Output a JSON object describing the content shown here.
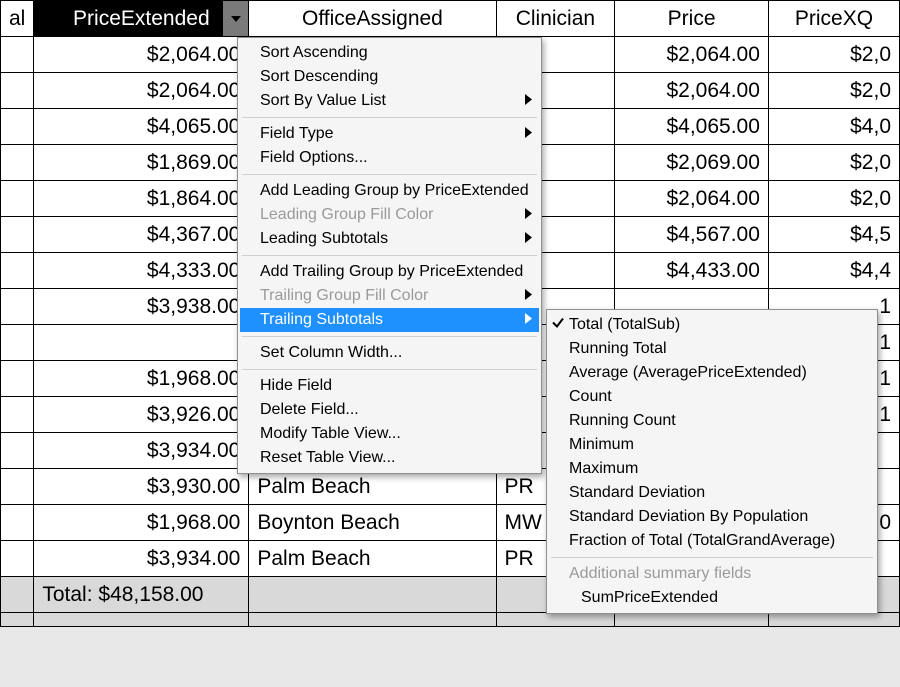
{
  "columns": {
    "stub": "al",
    "price_extended": "PriceExtended",
    "office_assigned": "OfficeAssigned",
    "clinician": "Clinician",
    "price": "Price",
    "price_xq": "PriceXQ"
  },
  "rows": [
    {
      "pe": "$2,064.00",
      "office": "",
      "clin": "",
      "price": "$2,064.00",
      "xq": "$2,0"
    },
    {
      "pe": "$2,064.00",
      "office": "",
      "clin": "",
      "price": "$2,064.00",
      "xq": "$2,0"
    },
    {
      "pe": "$4,065.00",
      "office": "",
      "clin": "",
      "price": "$4,065.00",
      "xq": "$4,0"
    },
    {
      "pe": "$1,869.00",
      "office": "",
      "clin": "",
      "price": "$2,069.00",
      "xq": "$2,0"
    },
    {
      "pe": "$1,864.00",
      "office": "",
      "clin": "",
      "price": "$2,064.00",
      "xq": "$2,0"
    },
    {
      "pe": "$4,367.00",
      "office": "",
      "clin": "",
      "price": "$4,567.00",
      "xq": "$4,5"
    },
    {
      "pe": "$4,333.00",
      "office": "",
      "clin": "",
      "price": "$4,433.00",
      "xq": "$4,4"
    },
    {
      "pe": "$3,938.00",
      "office": "",
      "clin": "",
      "price": "",
      "xq": "1"
    },
    {
      "pe": "",
      "office": "",
      "clin": "",
      "price": "",
      "xq": "1"
    },
    {
      "pe": "$1,968.00",
      "office": "",
      "clin": "",
      "price": "",
      "xq": "1"
    },
    {
      "pe": "$3,926.00",
      "office": "",
      "clin": "",
      "price": "",
      "xq": "1"
    },
    {
      "pe": "$3,934.00",
      "office": "",
      "clin": "",
      "price": "",
      "xq": ""
    },
    {
      "pe": "$3,930.00",
      "office": "Palm Beach",
      "clin": "PR",
      "price": "",
      "xq": ""
    },
    {
      "pe": "$1,968.00",
      "office": "Boynton Beach",
      "clin": "MW",
      "price": "",
      "xq": "0"
    },
    {
      "pe": "$3,934.00",
      "office": "Palm Beach",
      "clin": "PR",
      "price": "",
      "xq": ""
    }
  ],
  "total_label": "Total: $48,158.00",
  "menu_main": [
    {
      "label": "Sort Ascending",
      "disabled": false,
      "submenu": false
    },
    {
      "label": "Sort Descending",
      "disabled": false,
      "submenu": false
    },
    {
      "label": "Sort By Value List",
      "disabled": false,
      "submenu": true
    },
    {
      "sep": true
    },
    {
      "label": "Field Type",
      "disabled": false,
      "submenu": true
    },
    {
      "label": "Field Options...",
      "disabled": false,
      "submenu": false
    },
    {
      "sep": true
    },
    {
      "label": "Add Leading Group by PriceExtended",
      "disabled": false,
      "submenu": false
    },
    {
      "label": "Leading Group Fill Color",
      "disabled": true,
      "submenu": true
    },
    {
      "label": "Leading Subtotals",
      "disabled": false,
      "submenu": true
    },
    {
      "sep": true
    },
    {
      "label": "Add Trailing Group by PriceExtended",
      "disabled": false,
      "submenu": false
    },
    {
      "label": "Trailing Group Fill Color",
      "disabled": true,
      "submenu": true
    },
    {
      "label": "Trailing Subtotals",
      "disabled": false,
      "submenu": true,
      "highlight": true
    },
    {
      "sep": true
    },
    {
      "label": "Set Column Width...",
      "disabled": false,
      "submenu": false
    },
    {
      "sep": true
    },
    {
      "label": "Hide Field",
      "disabled": false,
      "submenu": false
    },
    {
      "label": "Delete Field...",
      "disabled": false,
      "submenu": false
    },
    {
      "label": "Modify Table View...",
      "disabled": false,
      "submenu": false
    },
    {
      "label": "Reset Table View...",
      "disabled": false,
      "submenu": false
    }
  ],
  "menu_sub": [
    {
      "label": "Total  (TotalSub)",
      "checked": true
    },
    {
      "label": "Running Total",
      "checked": false
    },
    {
      "label": "Average  (AveragePriceExtended)",
      "checked": false
    },
    {
      "label": "Count",
      "checked": false
    },
    {
      "label": "Running Count",
      "checked": false
    },
    {
      "label": "Minimum",
      "checked": false
    },
    {
      "label": "Maximum",
      "checked": false
    },
    {
      "label": "Standard Deviation",
      "checked": false
    },
    {
      "label": "Standard Deviation By Population",
      "checked": false
    },
    {
      "label": "Fraction of Total  (TotalGrandAverage)",
      "checked": false
    },
    {
      "sep": true
    },
    {
      "label": "Additional summary fields",
      "disabled": true
    },
    {
      "label": "SumPriceExtended",
      "indent": true
    }
  ]
}
